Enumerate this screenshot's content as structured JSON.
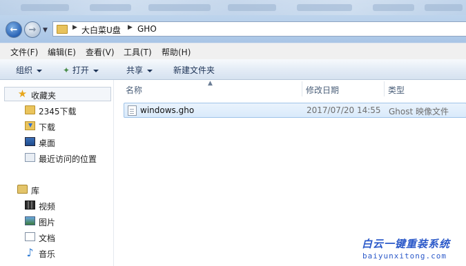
{
  "address": {
    "path": [
      "大白菜U盘",
      "GHO"
    ]
  },
  "menu": [
    "文件(F)",
    "编辑(E)",
    "查看(V)",
    "工具(T)",
    "帮助(H)"
  ],
  "commands": {
    "organize": "组织",
    "open": "打开",
    "share": "共享",
    "new_folder": "新建文件夹"
  },
  "sidebar": {
    "favorites_title": "收藏夹",
    "favorites": [
      {
        "label": "2345下载",
        "icon": "folder-icon"
      },
      {
        "label": "下载",
        "icon": "download-folder-icon"
      },
      {
        "label": "桌面",
        "icon": "desktop-icon"
      },
      {
        "label": "最近访问的位置",
        "icon": "recent-places-icon"
      }
    ],
    "libraries_title": "库",
    "libraries": [
      {
        "label": "视频",
        "icon": "video-icon"
      },
      {
        "label": "图片",
        "icon": "pictures-icon"
      },
      {
        "label": "文档",
        "icon": "documents-icon"
      },
      {
        "label": "音乐",
        "icon": "music-icon"
      }
    ]
  },
  "columns": {
    "name": "名称",
    "modified": "修改日期",
    "type": "类型"
  },
  "files": [
    {
      "name": "windows.gho",
      "modified": "2017/07/20 14:55",
      "type": "Ghost 映像文件"
    }
  ],
  "watermark": {
    "line1": "白云一键重装系统",
    "line2": "baiyunxitong.com"
  },
  "colors": {
    "accent": "#2b59c9",
    "selection_bg": "#d9eafb",
    "selection_border": "#9fc3e8"
  }
}
